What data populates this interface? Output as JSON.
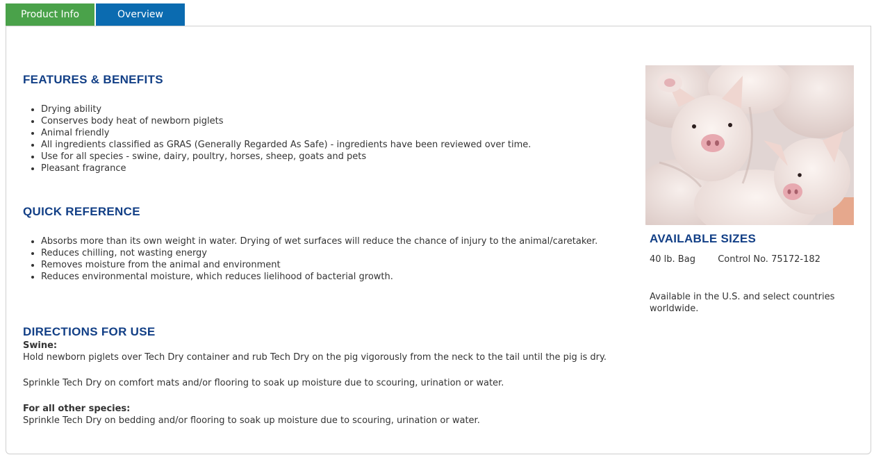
{
  "tabs": {
    "product_info": "Product Info",
    "overview": "Overview"
  },
  "features": {
    "heading": "FEATURES & BENEFITS",
    "items": [
      "Drying ability",
      "Conserves body heat of newborn piglets",
      "Animal friendly",
      "All ingredients classified as GRAS (Generally Regarded As Safe) - ingredients have been reviewed over time.",
      "Use for all species - swine, dairy, poultry, horses, sheep, goats and pets",
      "Pleasant fragrance"
    ]
  },
  "quick_reference": {
    "heading": "QUICK REFERENCE",
    "items": [
      "Absorbs more than its own weight in water. Drying of wet surfaces will reduce the chance of injury to the animal/caretaker.",
      "Reduces chilling, not wasting energy",
      "Removes moisture from the animal and environment",
      "Reduces environmental moisture, which reduces lielihood of bacterial growth."
    ]
  },
  "directions": {
    "heading": "DIRECTIONS FOR USE",
    "swine_label": "Swine:",
    "swine_text_1": "Hold newborn piglets over Tech Dry container and rub Tech Dry on the pig vigorously from the neck to the tail until the pig is dry.",
    "swine_text_2": "Sprinkle Tech Dry on comfort mats and/or flooring to soak up moisture due to scouring, urination or water.",
    "other_label": "For all other species:",
    "other_text": "Sprinkle Tech Dry on bedding and/or flooring to soak up moisture due to scouring, urination or water."
  },
  "sizes": {
    "heading": "AVAILABLE SIZES",
    "size": "40 lb. Bag",
    "control": "Control No. 75172-182",
    "availability": "Available in the U.S. and select countries worldwide."
  },
  "colors": {
    "tab_active": "#4aa24a",
    "tab_inactive": "#0b6bb0",
    "heading": "#123f86"
  }
}
